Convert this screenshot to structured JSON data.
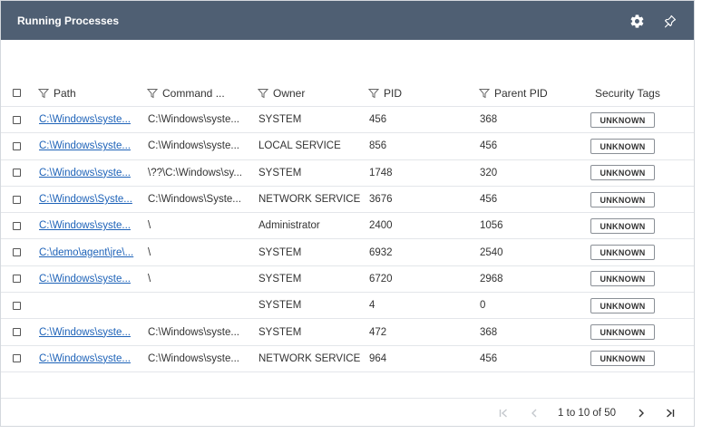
{
  "header": {
    "title": "Running Processes",
    "icons": [
      "gear-icon",
      "pin-icon"
    ]
  },
  "table": {
    "columns": {
      "path": "Path",
      "command": "Command ...",
      "owner": "Owner",
      "pid": "PID",
      "ppid": "Parent PID",
      "tags": "Security Tags"
    },
    "rows": [
      {
        "path": "C:\\Windows\\syste...",
        "command": "C:\\Windows\\syste...",
        "owner": "SYSTEM",
        "pid": "456",
        "ppid": "368",
        "tag": "UNKNOWN"
      },
      {
        "path": "C:\\Windows\\syste...",
        "command": "C:\\Windows\\syste...",
        "owner": "LOCAL SERVICE",
        "pid": "856",
        "ppid": "456",
        "tag": "UNKNOWN"
      },
      {
        "path": "C:\\Windows\\syste...",
        "command": "\\??\\C:\\Windows\\sy...",
        "owner": "SYSTEM",
        "pid": "1748",
        "ppid": "320",
        "tag": "UNKNOWN"
      },
      {
        "path": "C:\\Windows\\Syste...",
        "command": "C:\\Windows\\Syste...",
        "owner": "NETWORK SERVICE",
        "pid": "3676",
        "ppid": "456",
        "tag": "UNKNOWN"
      },
      {
        "path": "C:\\Windows\\syste...",
        "command": "\\",
        "owner": "Administrator",
        "pid": "2400",
        "ppid": "1056",
        "tag": "UNKNOWN"
      },
      {
        "path": "C:\\demo\\agent\\jre\\...",
        "command": "\\",
        "owner": "SYSTEM",
        "pid": "6932",
        "ppid": "2540",
        "tag": "UNKNOWN"
      },
      {
        "path": "C:\\Windows\\syste...",
        "command": "\\",
        "owner": "SYSTEM",
        "pid": "6720",
        "ppid": "2968",
        "tag": "UNKNOWN"
      },
      {
        "path": "",
        "command": "",
        "owner": "SYSTEM",
        "pid": "4",
        "ppid": "0",
        "tag": "UNKNOWN"
      },
      {
        "path": "C:\\Windows\\syste...",
        "command": "C:\\Windows\\syste...",
        "owner": "SYSTEM",
        "pid": "472",
        "ppid": "368",
        "tag": "UNKNOWN"
      },
      {
        "path": "C:\\Windows\\syste...",
        "command": "C:\\Windows\\syste...",
        "owner": "NETWORK SERVICE",
        "pid": "964",
        "ppid": "456",
        "tag": "UNKNOWN"
      }
    ]
  },
  "pagination": {
    "info": "1 to 10 of 50"
  },
  "colors": {
    "header_bg": "#4f5f73",
    "link": "#1d62b8"
  }
}
